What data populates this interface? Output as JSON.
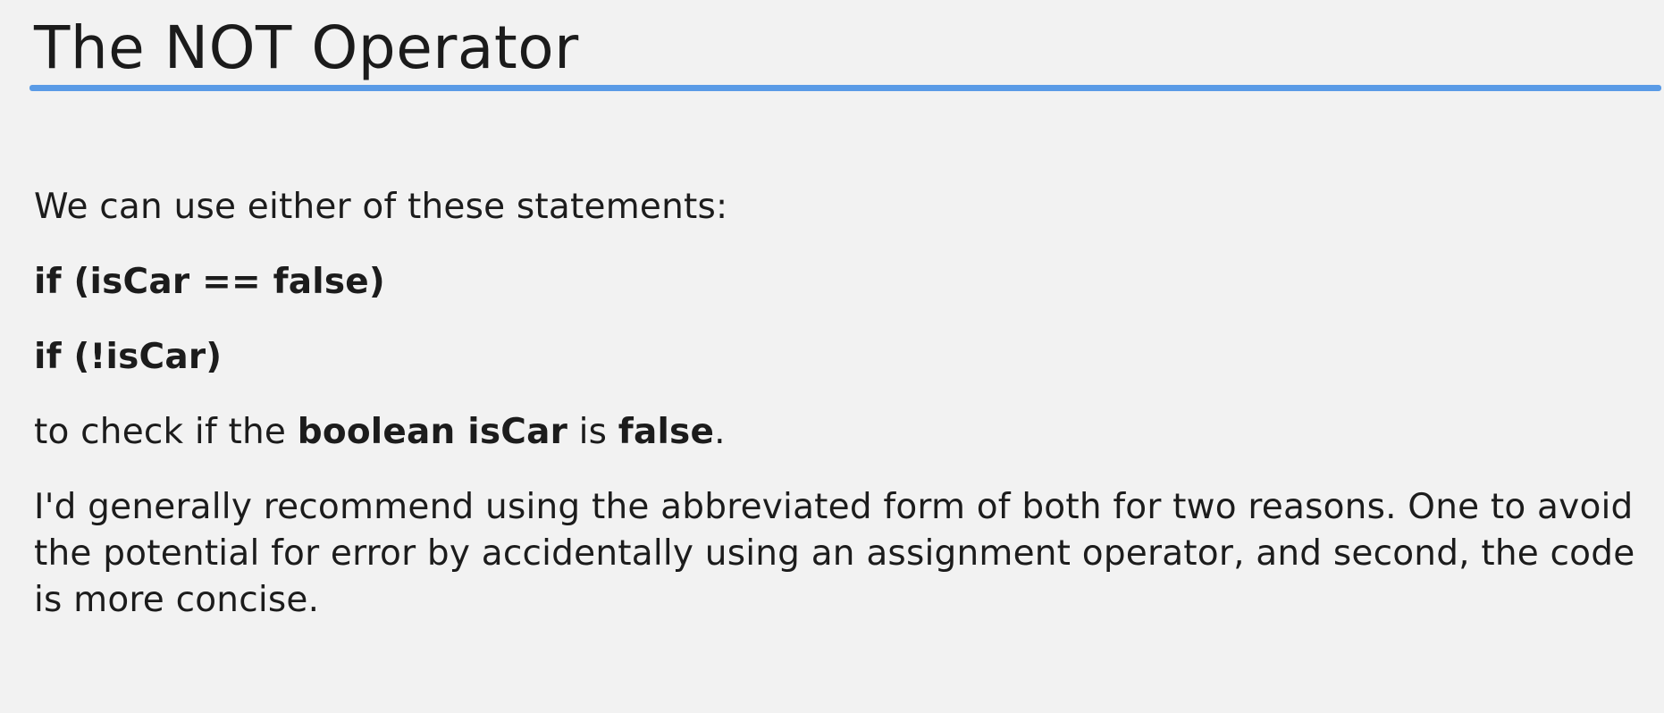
{
  "title": "The NOT Operator",
  "intro": "We can use either of these statements:",
  "statements": [
    "if (isCar == false)",
    "if (!isCar)"
  ],
  "check_line": {
    "prefix": "to check if the ",
    "bold_subject": "boolean isCar",
    "middle": " is ",
    "bold_value": "false",
    "suffix": "."
  },
  "recommendation": "I'd generally recommend using the abbreviated form of both for two reasons. One to avoid the potential for error by accidentally using an assignment operator, and second, the code is more concise.",
  "colors": {
    "background": "#f2f2f2",
    "accent_rule": "#5a9be6",
    "text": "#1c1c1c"
  }
}
